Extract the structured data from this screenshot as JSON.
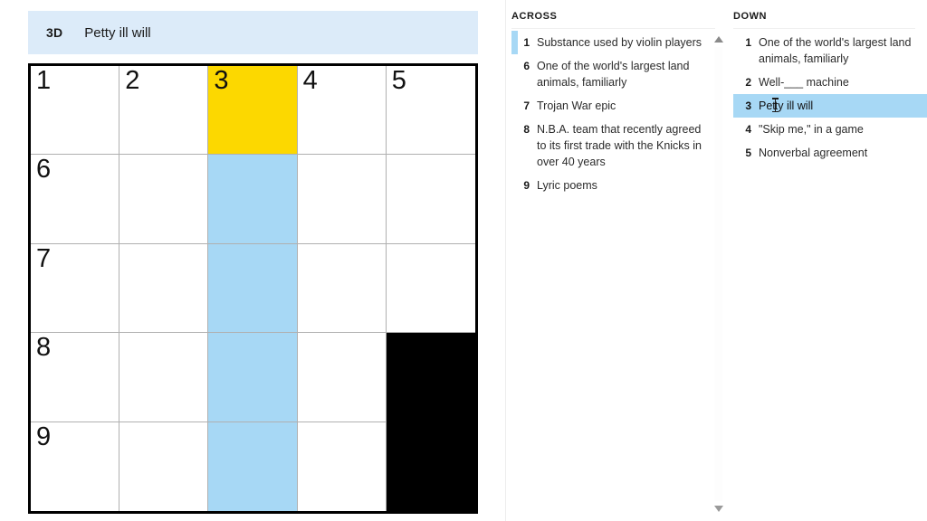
{
  "clue_bar": {
    "number": "3D",
    "text": "Petty ill will"
  },
  "grid": {
    "rows": 5,
    "cols": 5,
    "colors": {
      "active_cell": "#fcd800",
      "active_word": "#a7d8f5",
      "block": "#000000",
      "border": "#000000",
      "gridline": "#b0b0b0"
    },
    "cells": [
      [
        {
          "number": "1",
          "letter": "",
          "state": "empty"
        },
        {
          "number": "2",
          "letter": "",
          "state": "empty"
        },
        {
          "number": "3",
          "letter": "",
          "state": "active"
        },
        {
          "number": "4",
          "letter": "",
          "state": "empty"
        },
        {
          "number": "5",
          "letter": "",
          "state": "empty"
        }
      ],
      [
        {
          "number": "6",
          "letter": "",
          "state": "empty"
        },
        {
          "number": "",
          "letter": "",
          "state": "empty"
        },
        {
          "number": "",
          "letter": "",
          "state": "word"
        },
        {
          "number": "",
          "letter": "",
          "state": "empty"
        },
        {
          "number": "",
          "letter": "",
          "state": "empty"
        }
      ],
      [
        {
          "number": "7",
          "letter": "",
          "state": "empty"
        },
        {
          "number": "",
          "letter": "",
          "state": "empty"
        },
        {
          "number": "",
          "letter": "",
          "state": "word"
        },
        {
          "number": "",
          "letter": "",
          "state": "empty"
        },
        {
          "number": "",
          "letter": "",
          "state": "empty"
        }
      ],
      [
        {
          "number": "8",
          "letter": "",
          "state": "empty"
        },
        {
          "number": "",
          "letter": "",
          "state": "empty"
        },
        {
          "number": "",
          "letter": "",
          "state": "word"
        },
        {
          "number": "",
          "letter": "",
          "state": "empty"
        },
        {
          "number": "",
          "letter": "",
          "state": "block"
        }
      ],
      [
        {
          "number": "9",
          "letter": "",
          "state": "empty"
        },
        {
          "number": "",
          "letter": "",
          "state": "empty"
        },
        {
          "number": "",
          "letter": "",
          "state": "word"
        },
        {
          "number": "",
          "letter": "",
          "state": "empty"
        },
        {
          "number": "",
          "letter": "",
          "state": "block"
        }
      ]
    ]
  },
  "across": {
    "heading": "ACROSS",
    "clues": [
      {
        "number": "1",
        "text": "Substance used by violin players",
        "state": "marked"
      },
      {
        "number": "6",
        "text": "One of the world's largest land animals, familiarly",
        "state": "normal"
      },
      {
        "number": "7",
        "text": "Trojan War epic",
        "state": "normal"
      },
      {
        "number": "8",
        "text": "N.B.A. team that recently agreed to its first trade with the Knicks in over 40 years",
        "state": "normal"
      },
      {
        "number": "9",
        "text": "Lyric poems",
        "state": "normal"
      }
    ]
  },
  "down": {
    "heading": "DOWN",
    "clues": [
      {
        "number": "1",
        "text": "One of the world's largest land animals, familiarly",
        "state": "normal"
      },
      {
        "number": "2",
        "text": "Well-___ machine",
        "state": "normal"
      },
      {
        "number": "3",
        "text": "Petty ill will",
        "state": "selected",
        "caret_after": "Pet"
      },
      {
        "number": "4",
        "text": "\"Skip me,\" in a game",
        "state": "normal"
      },
      {
        "number": "5",
        "text": "Nonverbal agreement",
        "state": "normal"
      }
    ]
  },
  "scrollbar": {
    "up_icon": "triangle-up-icon",
    "down_icon": "triangle-down-icon"
  }
}
